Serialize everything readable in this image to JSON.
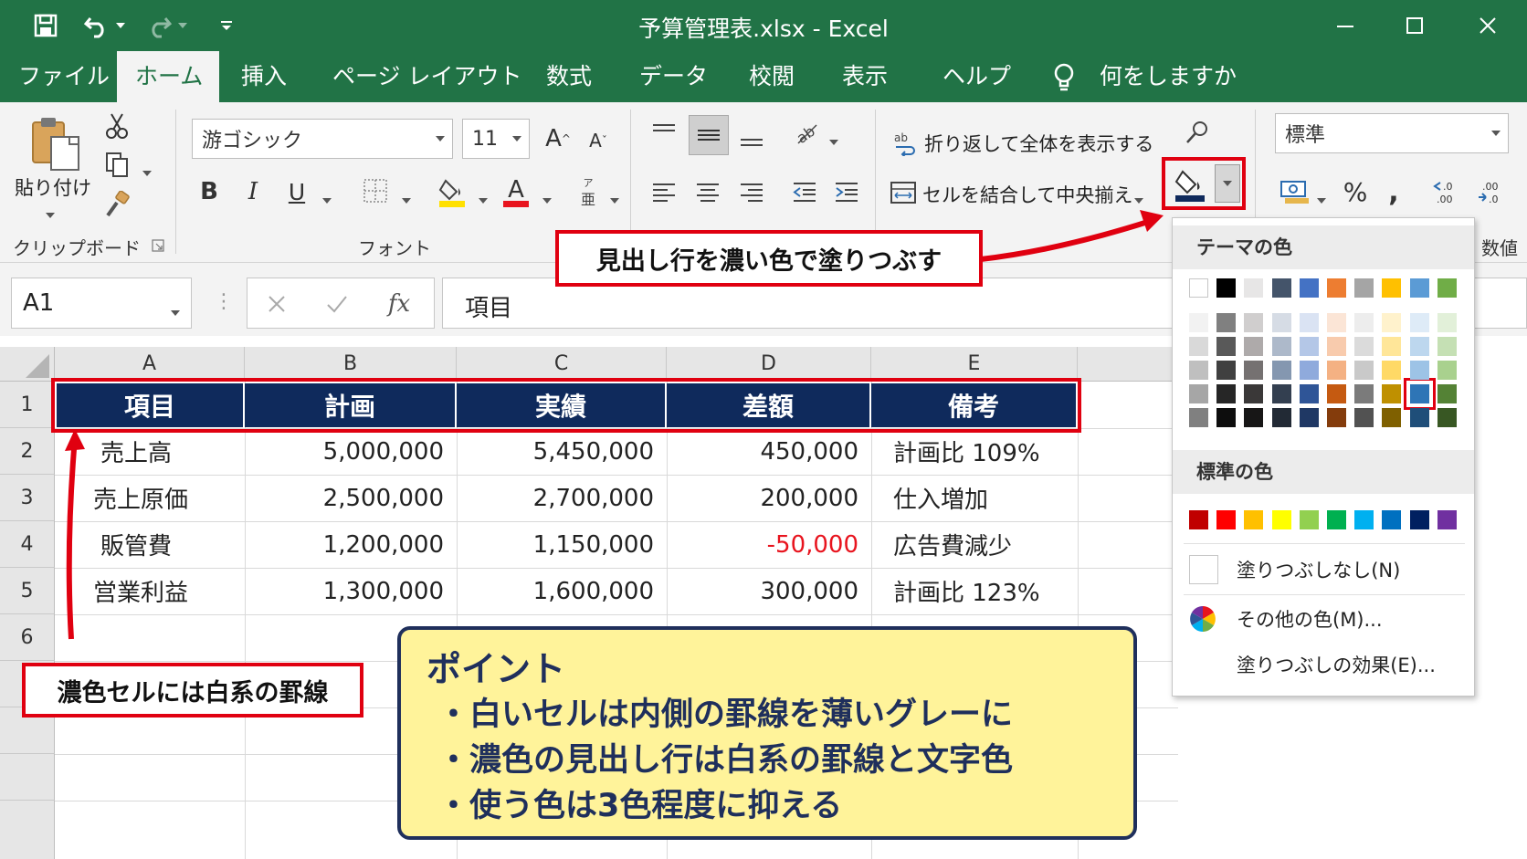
{
  "window": {
    "title": "予算管理表.xlsx  -  Excel"
  },
  "tabs": [
    {
      "label": "ファイル"
    },
    {
      "label": "ホーム"
    },
    {
      "label": "挿入"
    },
    {
      "label": "ページ レイアウト"
    },
    {
      "label": "数式"
    },
    {
      "label": "データ"
    },
    {
      "label": "校閲"
    },
    {
      "label": "表示"
    },
    {
      "label": "ヘルプ"
    },
    {
      "label": "何をしますか"
    }
  ],
  "ribbon": {
    "clipboard": {
      "paste_label": "貼り付け",
      "group_label": "クリップボード"
    },
    "font": {
      "font_name": "游ゴシック",
      "font_size": "11",
      "group_label": "フォント"
    },
    "alignment": {
      "wrap_label": "折り返して全体を表示する",
      "merge_label": "セルを結合して中央揃え"
    },
    "number": {
      "format": "標準",
      "group_label_partial": "数値"
    }
  },
  "formula_bar": {
    "name_box": "A1",
    "fx_label": "fx",
    "content": "項目"
  },
  "sheet": {
    "columns": [
      "A",
      "B",
      "C",
      "D",
      "E"
    ],
    "row_numbers": [
      "1",
      "2",
      "3",
      "4",
      "5",
      "6"
    ],
    "header": [
      "項目",
      "計画",
      "実績",
      "差額",
      "備考"
    ],
    "rows": [
      [
        "売上高",
        "5,000,000",
        "5,450,000",
        "450,000",
        "計画比 109%"
      ],
      [
        "売上原価",
        "2,500,000",
        "2,700,000",
        "200,000",
        "仕入増加"
      ],
      [
        "販管費",
        "1,200,000",
        "1,150,000",
        "-50,000",
        "広告費減少"
      ],
      [
        "営業利益",
        "1,300,000",
        "1,600,000",
        "300,000",
        "計画比 123%"
      ]
    ],
    "header_fill": "#0f2a5c",
    "negative_color": "#e8141e"
  },
  "color_menu": {
    "theme_label": "テーマの色",
    "standard_label": "標準の色",
    "no_fill": "塗りつぶしなし(N)",
    "more_colors": "その他の色(M)...",
    "fill_effects": "塗りつぶしの効果(E)...",
    "theme_top": [
      "#ffffff",
      "#000000",
      "#e7e6e6",
      "#44546a",
      "#4472c4",
      "#ed7d31",
      "#a5a5a5",
      "#ffc000",
      "#5b9bd5",
      "#70ad47"
    ],
    "theme_shades": [
      [
        "#f2f2f2",
        "#d9d9d9",
        "#bfbfbf",
        "#a6a6a6",
        "#808080"
      ],
      [
        "#808080",
        "#595959",
        "#404040",
        "#262626",
        "#0d0d0d"
      ],
      [
        "#d0cece",
        "#aeaaaa",
        "#757171",
        "#3a3838",
        "#171616"
      ],
      [
        "#d6dce5",
        "#adb9ca",
        "#8497b0",
        "#333f50",
        "#222a35"
      ],
      [
        "#dae3f3",
        "#b4c7e7",
        "#8faadc",
        "#2f5597",
        "#1f3864"
      ],
      [
        "#fbe5d6",
        "#f8cbad",
        "#f4b183",
        "#c55a11",
        "#843c0c"
      ],
      [
        "#ededed",
        "#dbdbdb",
        "#c9c9c9",
        "#7b7b7b",
        "#525252"
      ],
      [
        "#fff2cc",
        "#ffe699",
        "#ffd966",
        "#bf9000",
        "#7f6000"
      ],
      [
        "#deebf7",
        "#bdd7ee",
        "#9dc3e6",
        "#2e75b6",
        "#1f4e79"
      ],
      [
        "#e2f0d9",
        "#c5e0b4",
        "#a9d18e",
        "#548235",
        "#385723"
      ]
    ],
    "standard": [
      "#c00000",
      "#ff0000",
      "#ffc000",
      "#ffff00",
      "#92d050",
      "#00b050",
      "#00b0f0",
      "#0070c0",
      "#002060",
      "#7030a0"
    ],
    "selected": "#2e75b6"
  },
  "callouts": {
    "fill_header": "見出し行を濃い色で塗りつぶす",
    "border_note": "濃色セルには白系の罫線"
  },
  "point": {
    "title": "ポイント",
    "items": [
      "・白いセルは内側の罫線を薄いグレーに",
      "・濃色の見出し行は白系の罫線と文字色",
      "・使う色は3色程度に抑える"
    ]
  }
}
